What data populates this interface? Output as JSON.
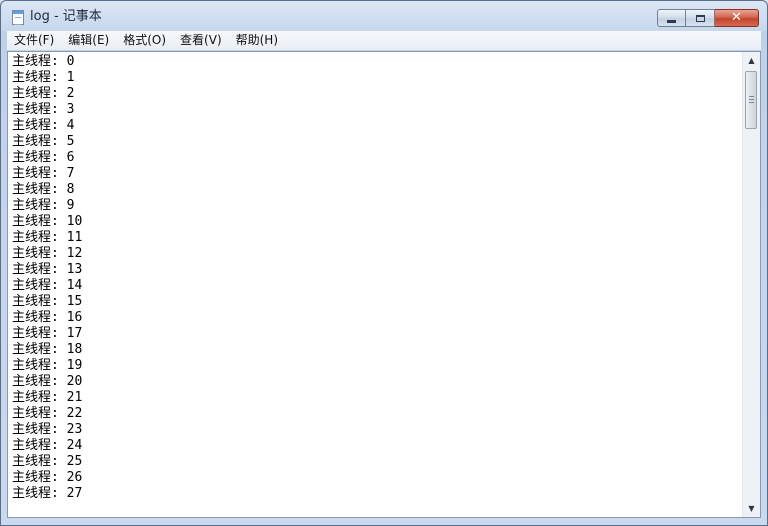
{
  "window": {
    "title": "log - 记事本",
    "icon": "notepad-icon"
  },
  "caption_buttons": {
    "minimize": "minimize-icon",
    "maximize": "maximize-icon",
    "close": "close-icon"
  },
  "menu": [
    {
      "label": "文件(F)"
    },
    {
      "label": "编辑(E)"
    },
    {
      "label": "格式(O)"
    },
    {
      "label": "查看(V)"
    },
    {
      "label": "帮助(H)"
    }
  ],
  "document": {
    "lines": [
      "主线程: 0",
      "主线程: 1",
      "主线程: 2",
      "主线程: 3",
      "主线程: 4",
      "主线程: 5",
      "主线程: 6",
      "主线程: 7",
      "主线程: 8",
      "主线程: 9",
      "主线程: 10",
      "主线程: 11",
      "主线程: 12",
      "主线程: 13",
      "主线程: 14",
      "主线程: 15",
      "主线程: 16",
      "主线程: 17",
      "主线程: 18",
      "主线程: 19",
      "主线程: 20",
      "主线程: 21",
      "主线程: 22",
      "主线程: 23",
      "主线程: 24",
      "主线程: 25",
      "主线程: 26",
      "主线程: 27"
    ]
  },
  "scrollbar": {
    "up_arrow": "▲",
    "down_arrow": "▼"
  }
}
